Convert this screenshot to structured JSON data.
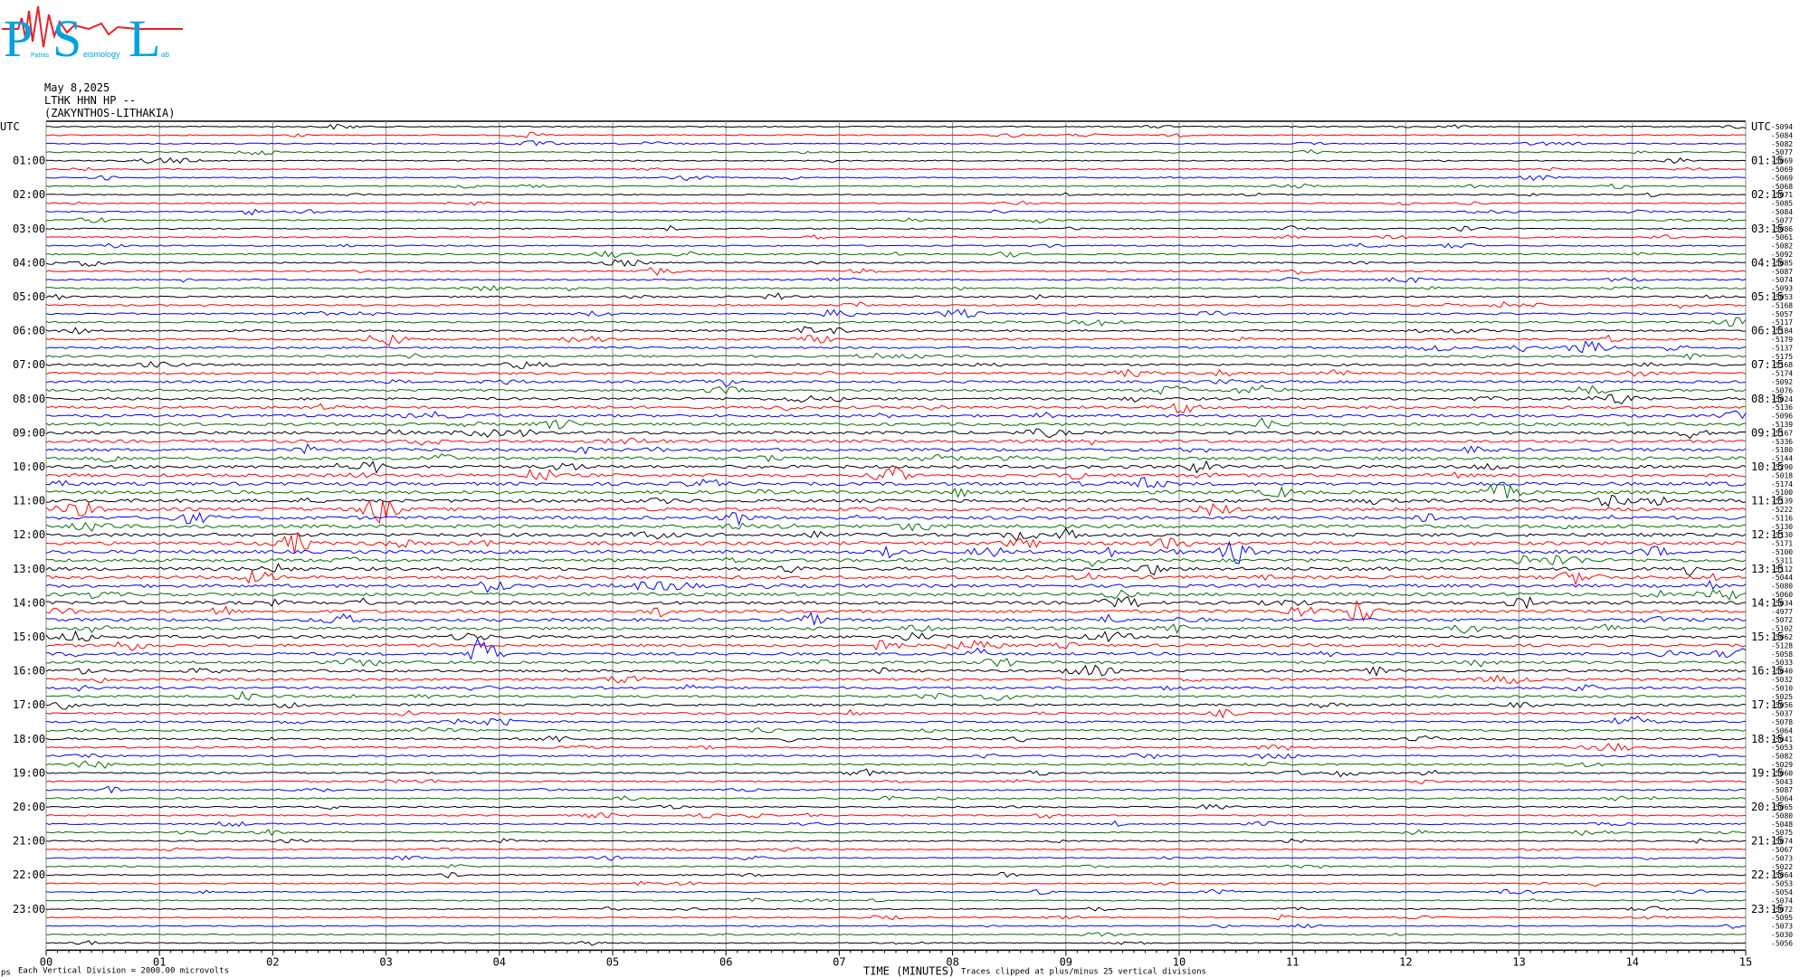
{
  "logo": {
    "letters": [
      "P",
      "S",
      "L"
    ],
    "words": [
      "Patras",
      "eismology",
      "ab"
    ],
    "colors": {
      "letters": "#00a3e0",
      "wave": "#e8202a"
    }
  },
  "header": {
    "date": "May 8,2025",
    "station": "LTHK HHN HP --",
    "location": "(ZAKYNTHOS-LITHAKIA)"
  },
  "chart_data": {
    "type": "line",
    "title": "",
    "xlabel": "TIME (MINUTES)",
    "left_axis_title": "UTC",
    "right_axis_title": "UTC",
    "x_ticks": [
      "00",
      "01",
      "02",
      "03",
      "04",
      "05",
      "06",
      "07",
      "08",
      "09",
      "10",
      "11",
      "12",
      "13",
      "14",
      "15"
    ],
    "xlim": [
      0,
      15
    ],
    "left_hour_labels": [
      "01:00",
      "02:00",
      "03:00",
      "04:00",
      "05:00",
      "06:00",
      "07:00",
      "08:00",
      "09:00",
      "10:00",
      "11:00",
      "12:00",
      "13:00",
      "14:00",
      "15:00",
      "16:00",
      "17:00",
      "18:00",
      "19:00",
      "20:00",
      "21:00",
      "22:00",
      "23:00"
    ],
    "right_hour_labels": [
      "01:15",
      "02:15",
      "03:15",
      "04:15",
      "05:15",
      "06:15",
      "07:15",
      "08:15",
      "09:15",
      "10:15",
      "11:15",
      "12:15",
      "13:15",
      "14:15",
      "15:15",
      "16:15",
      "17:15",
      "18:15",
      "19:15",
      "20:15",
      "21:15",
      "22:15",
      "23:15"
    ],
    "trace_colors": [
      "#000000",
      "#ff0000",
      "#0000ff",
      "#007000"
    ],
    "trace_offsets": [
      "-5094",
      "-5084",
      "-5082",
      "-5077",
      "-5069",
      "-5069",
      "-5069",
      "-5068",
      "-5071",
      "-5085",
      "-5084",
      "-5077",
      "-5086",
      "-5061",
      "-5082",
      "-5092",
      "-5085",
      "-5087",
      "-5074",
      "-5093",
      "-5053",
      "-5168",
      "-5057",
      "-5117",
      "-5184",
      "-5179",
      "-5137",
      "-5175",
      "-5168",
      "-5174",
      "-5092",
      "-5076",
      "-5024",
      "-5136",
      "-5096",
      "-5139",
      "-5167",
      "-5336",
      "-5180",
      "-5144",
      "-5290",
      "-5018",
      "-5174",
      "-5100",
      "-5139",
      "-5222",
      "-5116",
      "-5130",
      "-5130",
      "-5171",
      "-5100",
      "-5311",
      "-5112",
      "-5044",
      "-5080",
      "-5060",
      "-5034",
      "-4977",
      "-5072",
      "-5102",
      "-5062",
      "-5128",
      "-5058",
      "-5033",
      "-5040",
      "-5032",
      "-5010",
      "-5025",
      "-5056",
      "-5037",
      "-5078",
      "-5064",
      "-5041",
      "-5053",
      "-5082",
      "-5029",
      "-5060",
      "-5043",
      "-5087",
      "-5064",
      "-5065",
      "-5080",
      "-5048",
      "-5075",
      "-5074",
      "-5067",
      "-5073",
      "-5022",
      "-5064",
      "-5053",
      "-5054",
      "-5074",
      "-5072",
      "-5095",
      "-5073",
      "-5030",
      "-5056"
    ],
    "events": [
      {
        "trace": 41,
        "minute": 7.45,
        "amplitude": 10
      },
      {
        "trace": 45,
        "minute": 2.92,
        "amplitude": 14
      },
      {
        "trace": 49,
        "minute": 2.2,
        "amplitude": 12
      },
      {
        "trace": 50,
        "minute": 10.5,
        "amplitude": 12
      },
      {
        "trace": 57,
        "minute": 11.6,
        "amplitude": 14
      },
      {
        "trace": 62,
        "minute": 3.85,
        "amplitude": 18
      },
      {
        "trace": 41,
        "minute": 4.35,
        "amplitude": 8
      },
      {
        "trace": 25,
        "minute": 3.05,
        "amplitude": 7
      },
      {
        "trace": 22,
        "minute": 7.0,
        "amplitude": 7
      }
    ],
    "grid": "vertical-minutes"
  },
  "footer": {
    "left_mark": "ps",
    "division_note": "Each Vertical Division = 2000.00 microvolts",
    "clip_note": "Traces clipped at plus/minus 25 vertical divisions"
  }
}
